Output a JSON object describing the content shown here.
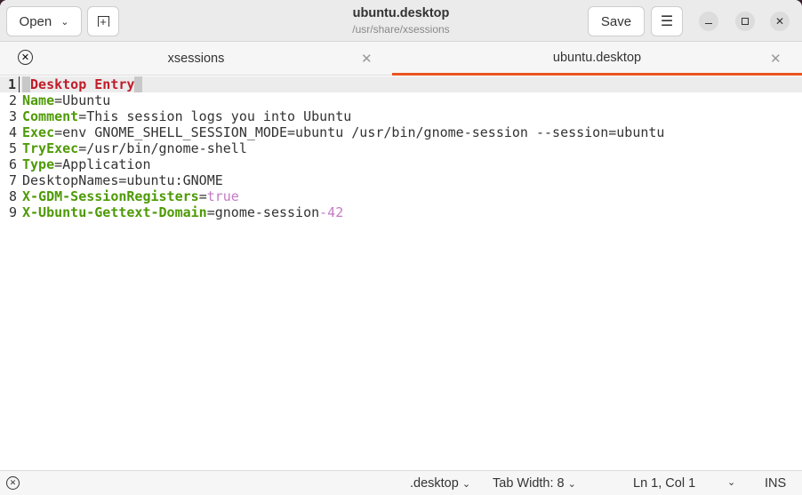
{
  "header": {
    "open_label": "Open",
    "title": "ubuntu.desktop",
    "path": "/usr/share/xsessions",
    "save_label": "Save"
  },
  "tabs": [
    {
      "label": "xsessions",
      "active": false
    },
    {
      "label": "ubuntu.desktop",
      "active": true
    }
  ],
  "colors": {
    "accent": "#e95420",
    "key": "#4e9a06",
    "section": "#c01c28",
    "literal": "#c57ac5"
  },
  "lines": [
    {
      "n": "1",
      "section": "Desktop Entry"
    },
    {
      "n": "2",
      "key": "Name",
      "value": "Ubuntu"
    },
    {
      "n": "3",
      "key": "Comment",
      "value": "This session logs you into Ubuntu"
    },
    {
      "n": "4",
      "key": "Exec",
      "value": "env GNOME_SHELL_SESSION_MODE=ubuntu /usr/bin/gnome-session --session=ubuntu"
    },
    {
      "n": "5",
      "key": "TryExec",
      "value": "/usr/bin/gnome-shell"
    },
    {
      "n": "6",
      "key": "Type",
      "value": "Application"
    },
    {
      "n": "7",
      "plain": "DesktopNames=ubuntu:GNOME"
    },
    {
      "n": "8",
      "key": "X-GDM-SessionRegisters",
      "literal": "true"
    },
    {
      "n": "9",
      "key": "X-Ubuntu-Gettext-Domain",
      "value": "gnome-session",
      "literal": "-42"
    }
  ],
  "status": {
    "language": ".desktop",
    "tab_width": "Tab Width: 8",
    "position": "Ln 1, Col 1",
    "mode": "INS"
  }
}
